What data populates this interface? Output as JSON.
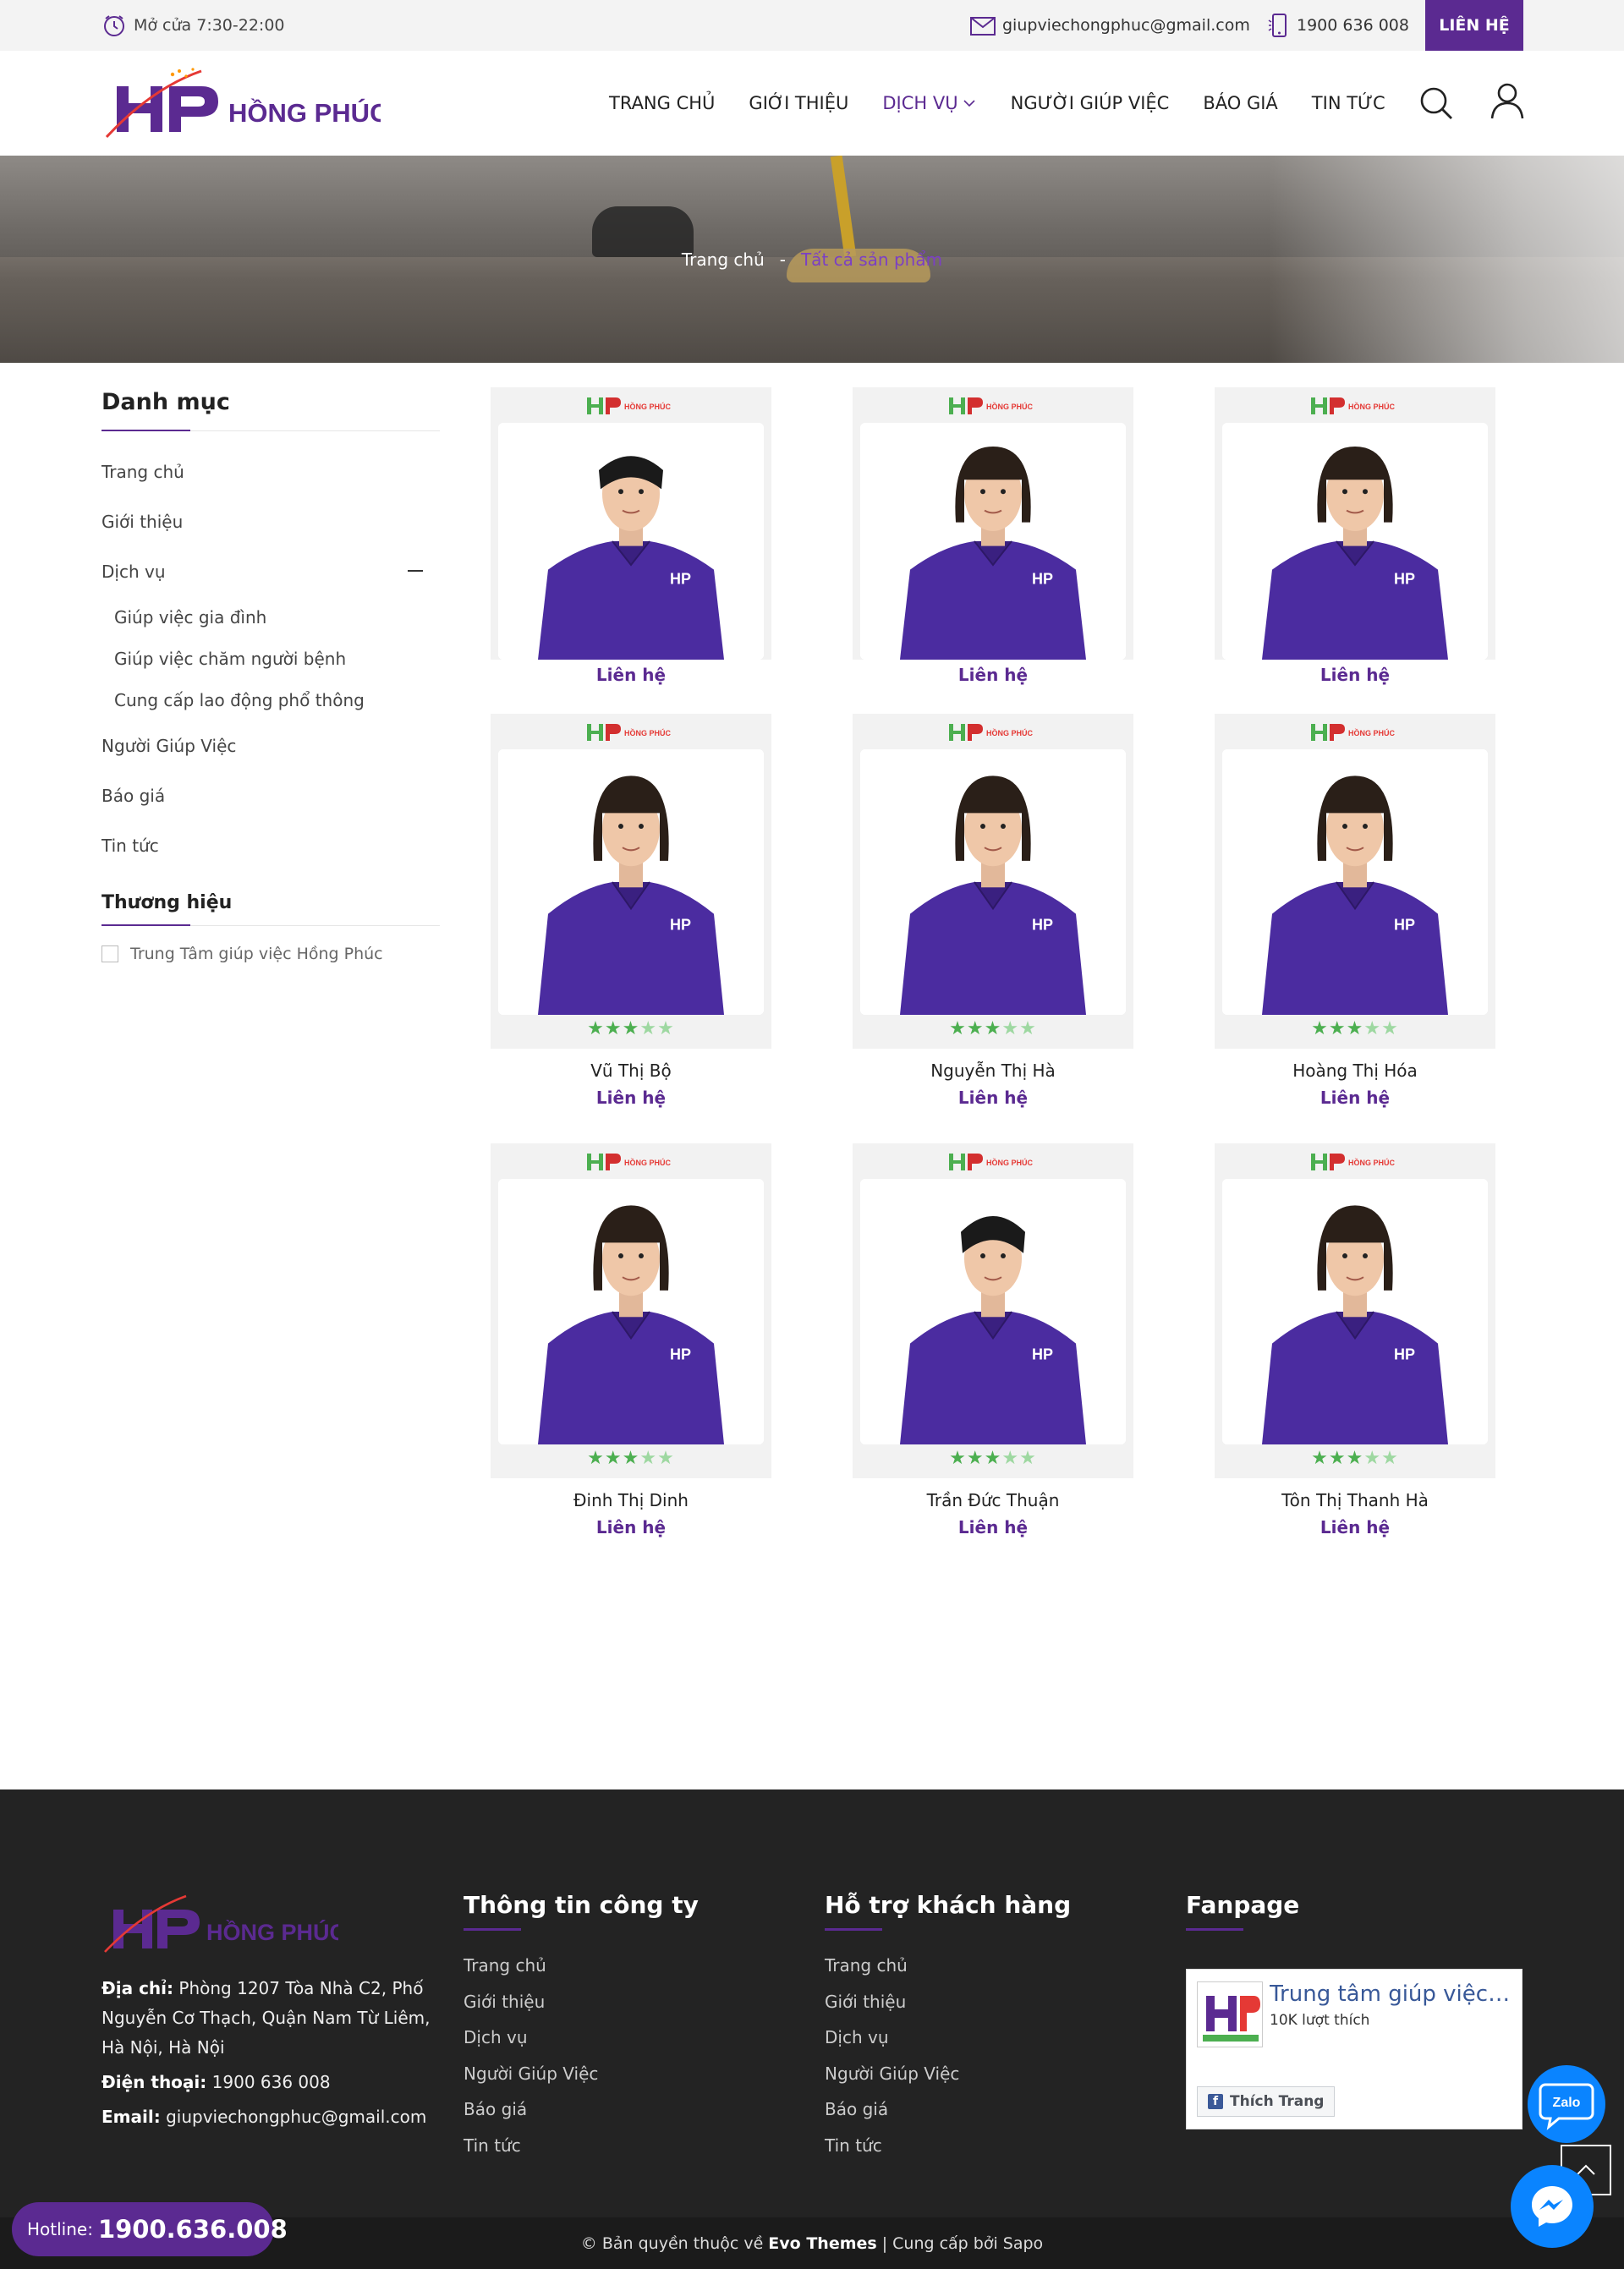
{
  "topbar": {
    "hours": "Mở cửa 7:30-22:00",
    "email": "giupviechongphuc@gmail.com",
    "phone": "1900 636 008",
    "contact_button": "LIÊN HỆ"
  },
  "header": {
    "logo_text": "HỒNG PHÚC",
    "nav": [
      "TRANG CHỦ",
      "GIỚI THIỆU",
      "DỊCH VỤ",
      "NGƯỜI GIÚP VIỆC",
      "BÁO GIÁ",
      "TIN TỨC"
    ],
    "active_nav": "DỊCH VỤ"
  },
  "breadcrumb": {
    "home": "Trang chủ",
    "separator": "-",
    "current": "Tất cả sản phẩm"
  },
  "sidebar": {
    "title": "Danh mục",
    "items": [
      {
        "label": "Trang chủ",
        "sub": false
      },
      {
        "label": "Giới thiệu",
        "sub": false
      },
      {
        "label": "Dịch vụ",
        "sub": false,
        "expanded": true
      },
      {
        "label": "Giúp việc gia đình",
        "sub": true
      },
      {
        "label": "Giúp việc chăm người bệnh",
        "sub": true
      },
      {
        "label": "Cung cấp lao động phổ thông",
        "sub": true
      },
      {
        "label": "Người Giúp Việc",
        "sub": false
      },
      {
        "label": "Báo giá",
        "sub": false
      },
      {
        "label": "Tin tức",
        "sub": false
      }
    ],
    "brand_title": "Thương hiệu",
    "brand_item": "Trung Tâm giúp việc Hồng Phúc"
  },
  "products": [
    {
      "name": "",
      "price": "Liên hệ",
      "gender": "m",
      "rating": 0
    },
    {
      "name": "",
      "price": "Liên hệ",
      "gender": "f",
      "rating": 0
    },
    {
      "name": "",
      "price": "Liên hệ",
      "gender": "f",
      "rating": 0
    },
    {
      "name": "Vũ Thị Bộ",
      "price": "Liên hệ",
      "gender": "f",
      "rating": 3
    },
    {
      "name": "Nguyễn Thị Hà",
      "price": "Liên hệ",
      "gender": "f",
      "rating": 3
    },
    {
      "name": "Hoàng Thị Hóa",
      "price": "Liên hệ",
      "gender": "f",
      "rating": 3
    },
    {
      "name": "Đinh Thị Dinh",
      "price": "Liên hệ",
      "gender": "f",
      "rating": 3
    },
    {
      "name": "Trần Đức Thuận",
      "price": "Liên hệ",
      "gender": "m",
      "rating": 3
    },
    {
      "name": "Tôn Thị Thanh Hà",
      "price": "Liên hệ",
      "gender": "f",
      "rating": 3
    }
  ],
  "footer": {
    "address_label": "Địa chỉ:",
    "address": "Phòng 1207 Tòa Nhà C2, Phố Nguyễn Cơ Thạch, Quận Nam Từ Liêm, Hà Nội, Hà Nội",
    "phone_label": "Điện thoại:",
    "phone": "1900 636 008",
    "email_label": "Email:",
    "email": "giupviechongphuc@gmail.com",
    "company_title": "Thông tin công ty",
    "support_title": "Hỗ trợ khách hàng",
    "fanpage_title": "Fanpage",
    "links": [
      "Trang chủ",
      "Giới thiệu",
      "Dịch vụ",
      "Người Giúp Việc",
      "Báo giá",
      "Tin tức"
    ],
    "fanpage_name": "Trung tâm giúp việc Hồng Phúc",
    "fanpage_likes": "10K lượt thích",
    "fanpage_like_button": "Thích Trang"
  },
  "copyright": {
    "prefix": "© Bản quyền thuộc về",
    "brand": "Evo Themes",
    "suffix": "| Cung cấp bởi Sapo"
  },
  "floating": {
    "hotline_label": "Hotline:",
    "hotline_number": "1900.636.008",
    "zalo_label": "Zalo"
  },
  "colors": {
    "brand_purple": "#5b2a91",
    "star_green": "#4caf50",
    "footer_bg": "#232323"
  }
}
